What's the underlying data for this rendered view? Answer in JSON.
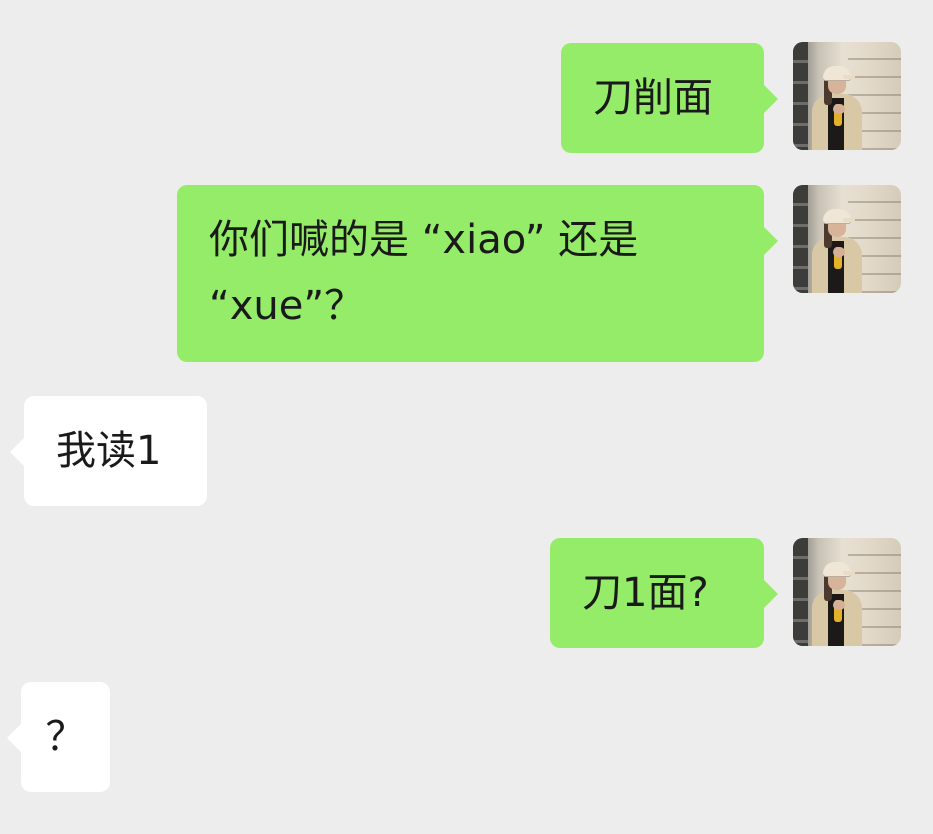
{
  "messages": [
    {
      "direction": "sent",
      "text": "刀削面"
    },
    {
      "direction": "sent",
      "text": "你们喊的是 “xiao” 还是\n“xue”？"
    },
    {
      "direction": "received",
      "text": "我读1"
    },
    {
      "direction": "sent",
      "text": "刀1面?"
    },
    {
      "direction": "received",
      "text": "？"
    }
  ],
  "colors": {
    "background": "#ededed",
    "sent_bubble": "#95ec69",
    "received_bubble": "#ffffff",
    "text": "#1a1a1a"
  }
}
